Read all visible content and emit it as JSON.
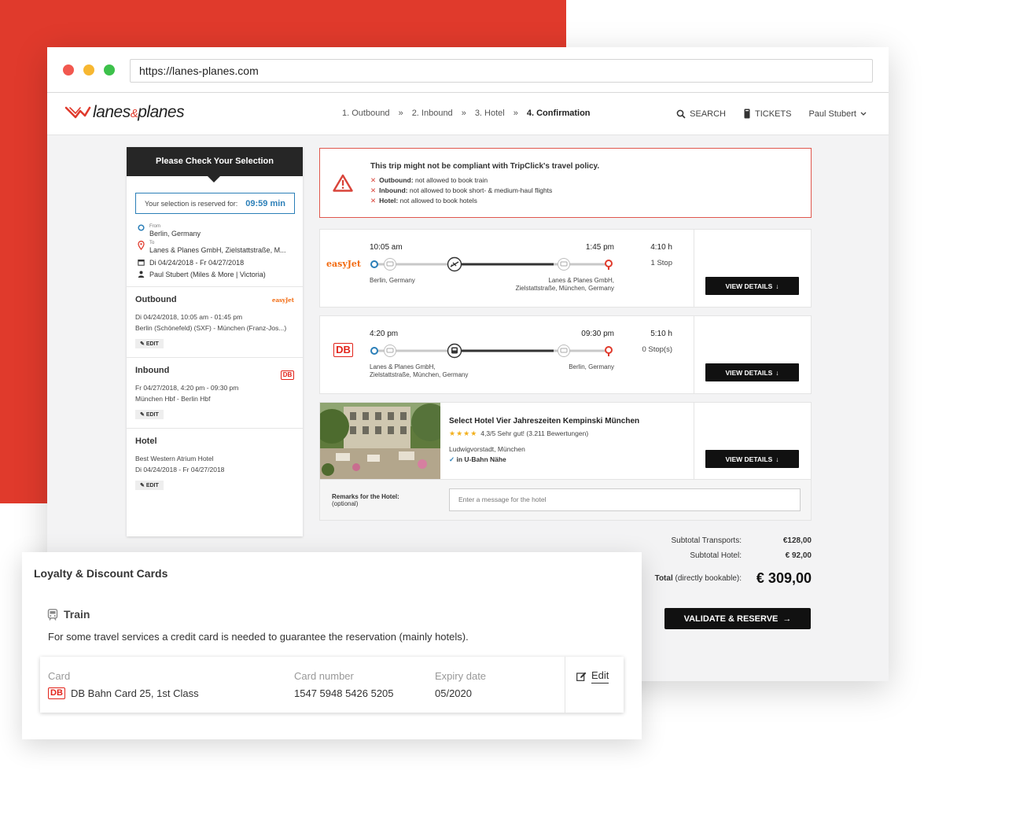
{
  "browser": {
    "url": "https://lanes-planes.com"
  },
  "header": {
    "logo": {
      "left": "lanes",
      "amp": "&",
      "right": "planes"
    },
    "steps": [
      {
        "label": "1. Outbound"
      },
      {
        "label": "2. Inbound"
      },
      {
        "label": "3. Hotel"
      },
      {
        "label": "4. Confirmation",
        "active": true
      }
    ],
    "step_separator": "»",
    "search_label": "SEARCH",
    "tickets_label": "TICKETS",
    "user_name": "Paul Stubert"
  },
  "summary": {
    "title": "Please Check Your Selection",
    "reserved_label": "Your selection is reserved for:",
    "reserved_time": "09:59 min",
    "from_label": "From",
    "from_value": "Berlin, Germany",
    "to_label": "To",
    "to_value": "Lanes & Planes GmbH, Zielstattstraße, M...",
    "dates": "Di 04/24/2018 - Fr 04/27/2018",
    "traveller": "Paul Stubert (Miles & More | Victoria)",
    "outbound": {
      "title": "Outbound",
      "line1": "Di 04/24/2018, 10:05 am - 01:45 pm",
      "line2": "Berlin (Schönefeld) (SXF) - München (Franz-Jos...)",
      "edit": "EDIT",
      "logo": "easyJet"
    },
    "inbound": {
      "title": "Inbound",
      "line1": "Fr 04/27/2018, 4:20 pm - 09:30 pm",
      "line2": "München Hbf - Berlin Hbf",
      "edit": "EDIT",
      "logo": "DB"
    },
    "hotel": {
      "title": "Hotel",
      "line1": "Best Western Atrium Hotel",
      "line2": "Di 04/24/2018 - Fr 04/27/2018",
      "edit": "EDIT"
    }
  },
  "alert": {
    "title": "This trip might not be compliant with TripClick's travel policy.",
    "items": [
      {
        "label": "Outbound:",
        "text": "not allowed to book train"
      },
      {
        "label": "Inbound:",
        "text": "not allowed to book short- & medium-haul flights"
      },
      {
        "label": "Hotel:",
        "text": "not allowed to book hotels"
      }
    ],
    "colors": {
      "border": "#e0574d",
      "icon": "#d9443a"
    }
  },
  "outbound_card": {
    "carrier": "easyJet",
    "depart_time": "10:05 am",
    "arrive_time": "1:45 pm",
    "duration": "4:10 h",
    "stops": "1 Stop",
    "from_place": "Berlin, Germany",
    "to_place_1": "Lanes & Planes GmbH,",
    "to_place_2": "Zielstattstraße, München, Germany",
    "mode_icon": "plane-icon",
    "button": "VIEW DETAILS"
  },
  "inbound_card": {
    "carrier": "DB",
    "depart_time": "4:20 pm",
    "arrive_time": "09:30 pm",
    "duration": "5:10 h",
    "stops": "0 Stop(s)",
    "from_place_1": "Lanes & Planes GmbH,",
    "from_place_2": "Zielstattstraße, München, Germany",
    "to_place": "Berlin, Germany",
    "mode_icon": "train-icon",
    "button": "VIEW DETAILS"
  },
  "hotel_card": {
    "name": "Select Hotel Vier Jahreszeiten Kempinski München",
    "stars": "★★★★",
    "rating": "4,3/5 Sehr gut! (3.211 Bewertungen)",
    "district": "Ludwigvorstadt, München",
    "feature": "in U-Bahn Nähe",
    "button": "VIEW DETAILS",
    "remarks_label": "Remarks for the Hotel:",
    "remarks_optional": "(optional)",
    "remarks_placeholder": "Enter a message for the hotel"
  },
  "totals": {
    "subtotal_transports_label": "Subtotal Transports:",
    "subtotal_transports": "€128,00",
    "subtotal_hotel_label": "Subtotal Hotel:",
    "subtotal_hotel": "€ 92,00",
    "total_label": "Total",
    "total_note": "(directly bookable):",
    "total": "€ 309,00",
    "validate_button": "VALIDATE & RESERVE"
  },
  "loyalty": {
    "title": "Loyalty & Discount Cards",
    "section": "Train",
    "description": "For some travel services a credit card is needed to guarantee the reservation (mainly hotels).",
    "card_header": "Card",
    "card_value": "DB Bahn Card 25, 1st Class",
    "number_header": "Card number",
    "number_value": "1547 5948 5426 5205",
    "expiry_header": "Expiry date",
    "expiry_value": "05/2020",
    "edit": "Edit"
  },
  "colors": {
    "brand_red": "#e03a2c",
    "accent_blue": "#2b7fb8",
    "db_red": "#e2231a",
    "easyjet_orange": "#f26a0f",
    "dark_button": "#111111"
  }
}
